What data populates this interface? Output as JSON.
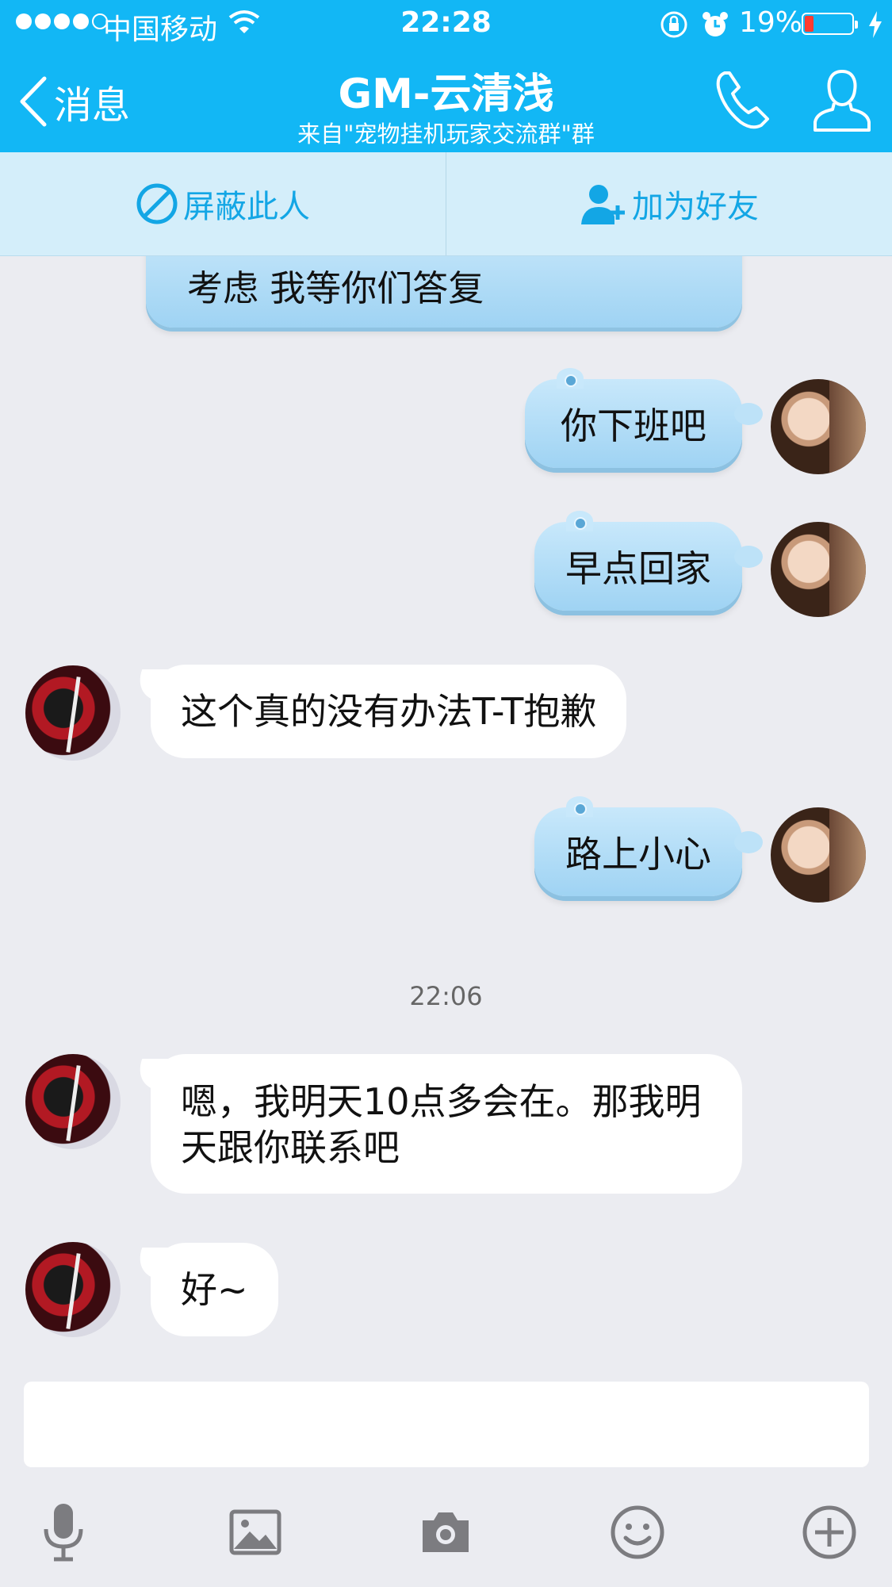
{
  "status_bar": {
    "carrier": "中国移动",
    "time": "22:28",
    "battery_percent_text": "19%",
    "battery_level": 0.19,
    "battery_color": "#ff3b30"
  },
  "header": {
    "back_label": "消息",
    "title": "GM-云清浅",
    "subtitle": "来自\"宠物挂机玩家交流群\"群",
    "background": "#12b7f5"
  },
  "actions": {
    "block_label": "屏蔽此人",
    "add_friend_label": "加为好友",
    "accent": "#13a6e5"
  },
  "messages": [
    {
      "from": "other-partial",
      "text": "考虑 我等你们答复"
    },
    {
      "from": "me",
      "text": "你下班吧"
    },
    {
      "from": "me",
      "text": "早点回家"
    },
    {
      "from": "other",
      "text": "这个真的没有办法T-T抱歉"
    },
    {
      "from": "me",
      "text": "路上小心"
    },
    {
      "from": "system-time",
      "text": "22:06"
    },
    {
      "from": "other",
      "text": "嗯，我明天10点多会在。那我明天跟你联系吧"
    },
    {
      "from": "other",
      "text": "好~"
    }
  ],
  "toolbar": {
    "icons": [
      "microphone-icon",
      "image-icon",
      "camera-icon",
      "emoji-icon",
      "plus-icon"
    ]
  }
}
